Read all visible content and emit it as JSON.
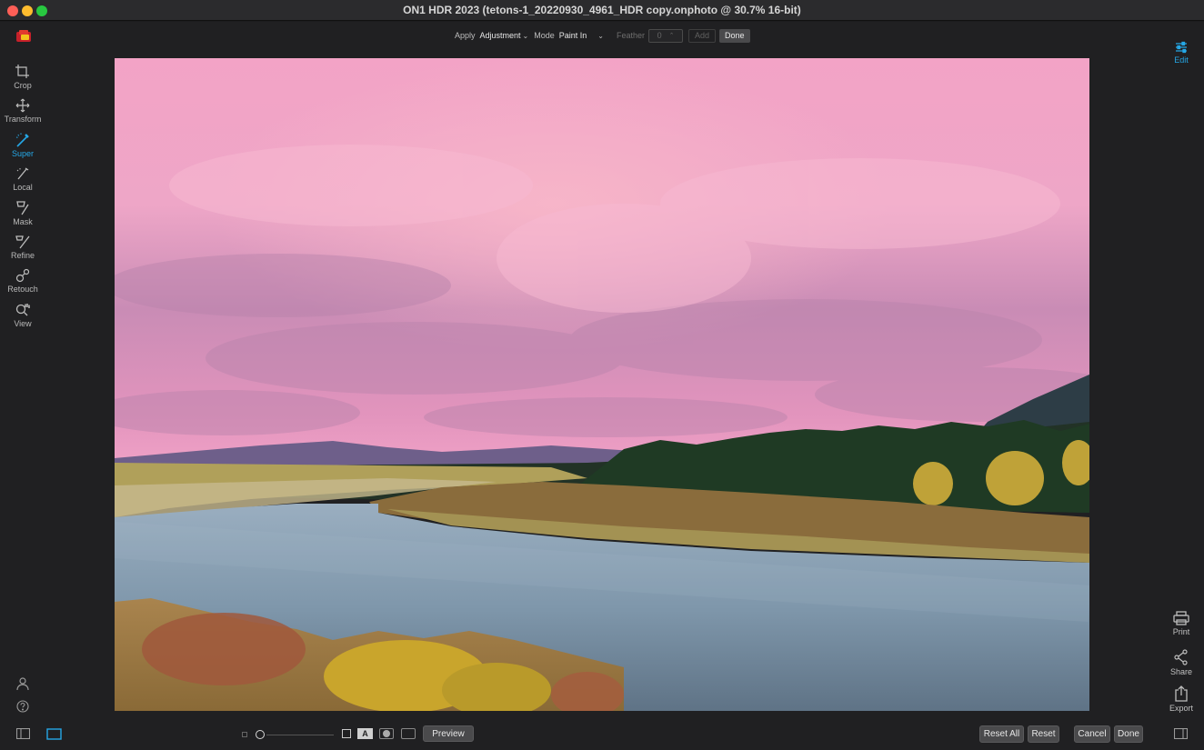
{
  "window": {
    "title": "ON1 HDR 2023 (tetons-1_20220930_4961_HDR copy.onphoto @ 30.7% 16-bit)"
  },
  "option_bar": {
    "apply_label": "Apply",
    "apply_value": "Adjustment",
    "mode_label": "Mode",
    "mode_value": "Paint In",
    "feather_label": "Feather",
    "feather_value": "0",
    "add_label": "Add",
    "done_label": "Done"
  },
  "left_tools": [
    {
      "label": "Crop",
      "icon": "crop-icon"
    },
    {
      "label": "Transform",
      "icon": "move-icon"
    },
    {
      "label": "Super",
      "icon": "magic-brush-icon",
      "active": true
    },
    {
      "label": "Local",
      "icon": "brush-icon"
    },
    {
      "label": "Mask",
      "icon": "mask-brush-icon"
    },
    {
      "label": "Refine",
      "icon": "refine-brush-icon"
    },
    {
      "label": "Retouch",
      "icon": "retouch-icon"
    },
    {
      "label": "View",
      "icon": "zoom-hand-icon"
    }
  ],
  "right_tools": {
    "edit": "Edit",
    "print": "Print",
    "share": "Share",
    "export": "Export"
  },
  "bottom_bar": {
    "preview_label": "Preview",
    "reset_all_label": "Reset All",
    "reset_label": "Reset",
    "cancel_label": "Cancel",
    "done_label": "Done",
    "mask_view_a": "A"
  },
  "colors": {
    "accent": "#25a7e6",
    "background": "#202022"
  }
}
